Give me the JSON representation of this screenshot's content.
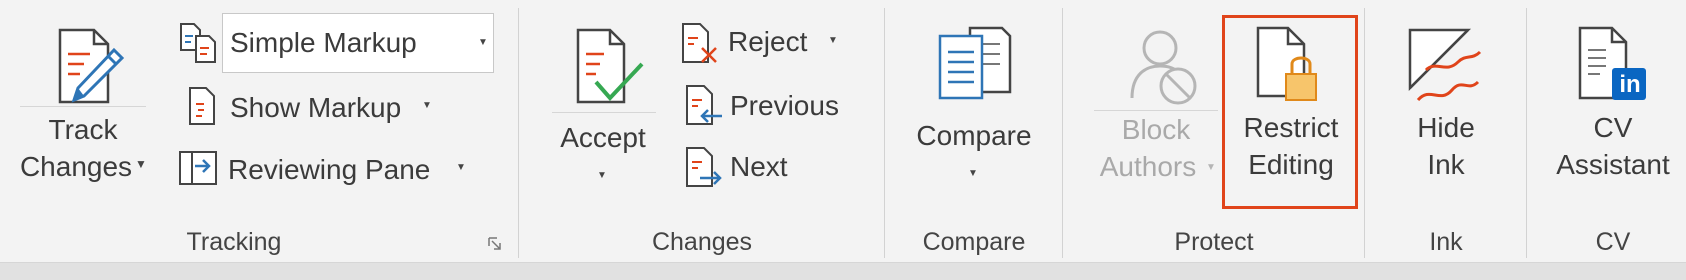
{
  "tracking": {
    "track_changes": {
      "line1": "Track",
      "line2": "Changes"
    },
    "markup_select": {
      "value": "Simple Markup"
    },
    "show_markup": "Show Markup",
    "reviewing_pane": "Reviewing Pane",
    "group_label": "Tracking"
  },
  "changes": {
    "accept": "Accept",
    "reject": "Reject",
    "previous": "Previous",
    "next": "Next",
    "group_label": "Changes"
  },
  "compare": {
    "compare": "Compare",
    "group_label": "Compare"
  },
  "protect": {
    "block_authors": {
      "line1": "Block",
      "line2": "Authors"
    },
    "restrict_editing": {
      "line1": "Restrict",
      "line2": "Editing"
    },
    "group_label": "Protect"
  },
  "ink": {
    "hide_ink": {
      "line1": "Hide",
      "line2": "Ink"
    },
    "group_label": "Ink"
  },
  "cv": {
    "cv_assistant": {
      "line1": "CV",
      "line2": "Assistant"
    },
    "badge": "in",
    "group_label": "CV"
  },
  "colors": {
    "accent_red": "#e0441a",
    "blue": "#2e75b6",
    "green": "#36a852",
    "lock_gold": "#f7c56b",
    "linkedin_blue": "#0a66c2"
  }
}
